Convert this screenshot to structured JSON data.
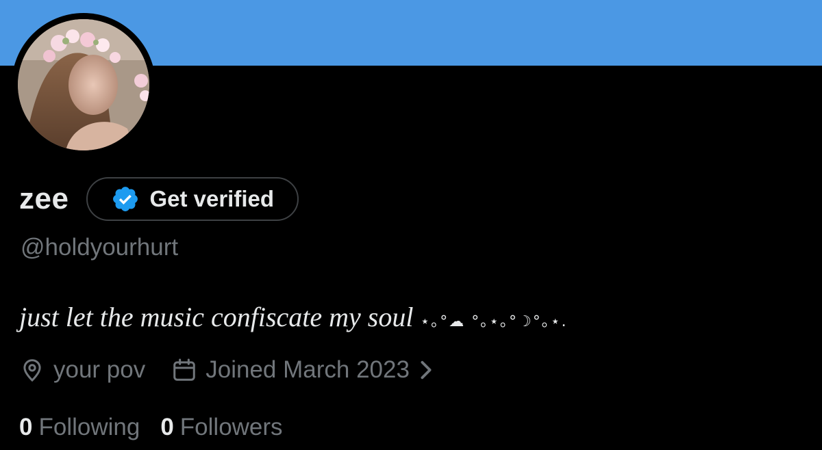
{
  "theme": {
    "banner_color": "#4b98e4",
    "background": "#000000",
    "text_primary": "#e7e9ea",
    "text_secondary": "#71767b",
    "verified_blue": "#1d9bf0"
  },
  "profile": {
    "display_name": "zee",
    "handle": "@holdyourhurt",
    "get_verified_label": "Get verified",
    "bio_text": "just let the music confiscate my soul",
    "bio_decoration": "⋆｡°☁︎ °｡⋆｡°☽°｡⋆.",
    "location": "your pov",
    "joined": "Joined March 2023",
    "following_count": "0",
    "following_label": "Following",
    "followers_count": "0",
    "followers_label": "Followers"
  },
  "icons": {
    "verified": "verified-badge-icon",
    "location": "location-pin-icon",
    "calendar": "calendar-icon",
    "chevron": "chevron-right-icon"
  }
}
